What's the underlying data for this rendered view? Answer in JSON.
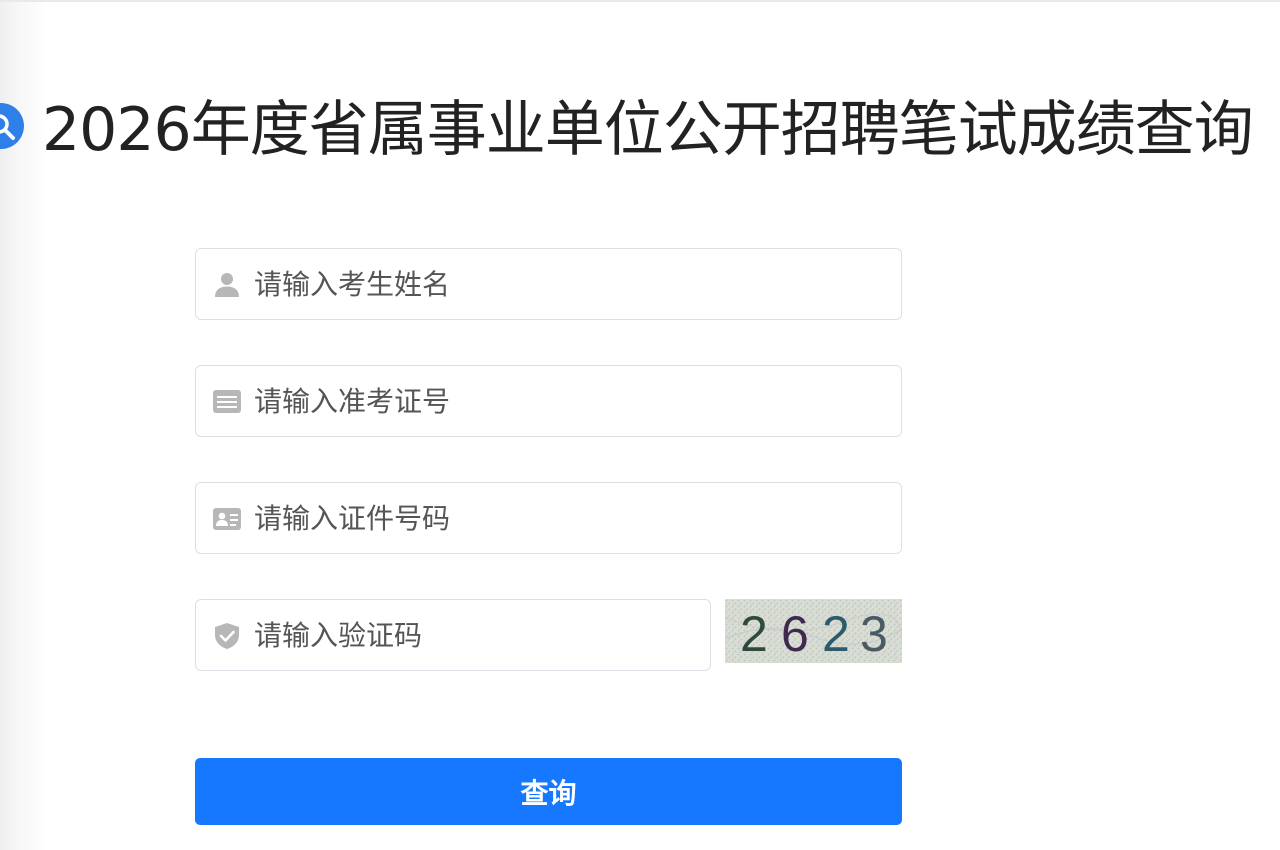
{
  "header": {
    "title": "2026年度省属事业单位公开招聘笔试成绩查询",
    "icon": "search-icon"
  },
  "form": {
    "name_field": {
      "placeholder": "请输入考生姓名",
      "icon": "user-icon"
    },
    "exam_number_field": {
      "placeholder": "请输入准考证号",
      "icon": "card-list-icon"
    },
    "id_number_field": {
      "placeholder": "请输入证件号码",
      "icon": "id-card-icon"
    },
    "captcha_field": {
      "placeholder": "请输入验证码",
      "icon": "shield-check-icon"
    },
    "captcha_image": {
      "digits": [
        "2",
        "6",
        "2",
        "3"
      ],
      "digit_colors": [
        "#2f4a3c",
        "#3e2a4e",
        "#2d5a6a",
        "#4a5a64"
      ]
    },
    "submit_label": "查询"
  },
  "colors": {
    "accent": "#1677ff",
    "title_icon": "#2f7fe8",
    "input_icon": "#b7b7b7",
    "border": "#dcdfe6"
  }
}
